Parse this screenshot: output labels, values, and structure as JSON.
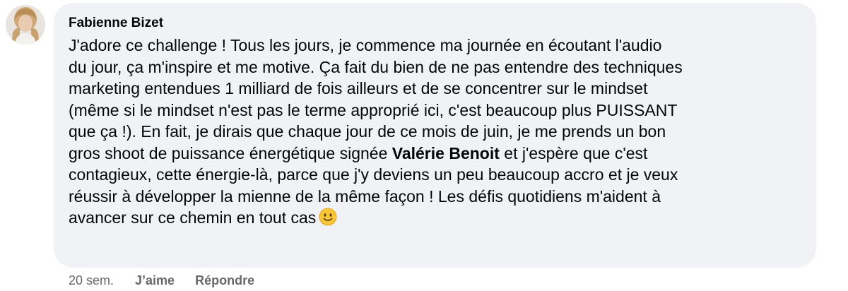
{
  "comment": {
    "author": "Fabienne Bizet",
    "text_before_mention": "J'adore ce challenge ! Tous les jours, je commence ma journée en écoutant l'audio\ndu jour, ça m'inspire et me motive. Ça fait du bien de ne pas entendre des techniques\nmarketing entendues 1 milliard de fois ailleurs et de se concentrer sur le mindset\n(même si le mindset n'est pas le terme approprié ici, c'est beaucoup plus PUISSANT\nque ça !). En fait, je dirais que chaque jour de ce mois de juin, je me prends un bon\ngros shoot de puissance énergétique signée ",
    "mention": "Valérie Benoit",
    "text_after_mention": " et j'espère que c'est\ncontagieux, cette énergie-là, parce que j'y deviens un peu beaucoup accro et je veux\nréussir à développer la mienne de la même façon ! Les défis quotidiens m'aident à\navancer sur ce chemin en tout cas",
    "emoji": "slightly-smiling-face-icon"
  },
  "actions": {
    "timestamp": "20 sem.",
    "like_label": "J’aime",
    "reply_label": "Répondre"
  },
  "colors": {
    "bubble_bg": "#f0f2f5",
    "text": "#050505",
    "secondary_text": "#65676b",
    "emoji_yellow": "#f7c739"
  }
}
